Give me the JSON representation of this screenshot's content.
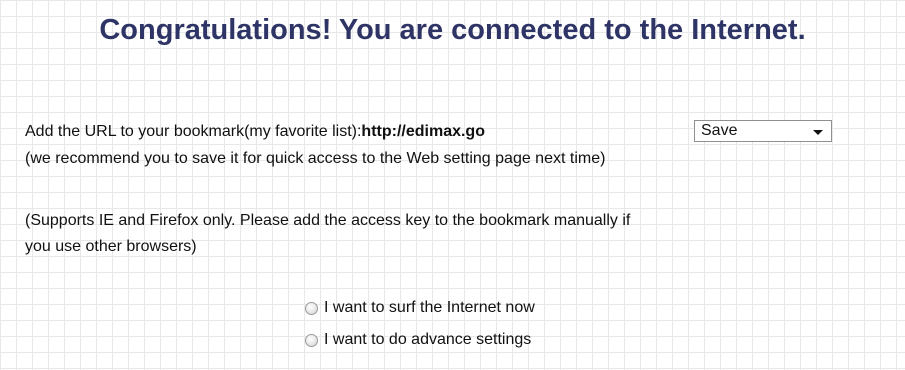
{
  "heading": "Congratulations! You are connected to the Internet.",
  "bookmark": {
    "prefix": "Add the URL to your bookmark(my favorite list):",
    "url": "http://edimax.go",
    "select_value": "Save",
    "recommend": "(we recommend you to save it for quick access to the Web setting page next time)"
  },
  "support": {
    "line1": "(Supports IE and Firefox only. Please add the access key to the bookmark manually if",
    "line2": "you use other browsers)"
  },
  "options": [
    {
      "label": "I want to surf the Internet now"
    },
    {
      "label": "I want to do advance settings"
    }
  ],
  "colors": {
    "heading": "#2e3465",
    "grid": "#e8e8e8"
  },
  "icons": {
    "dropdown": "chevron-down-icon"
  }
}
